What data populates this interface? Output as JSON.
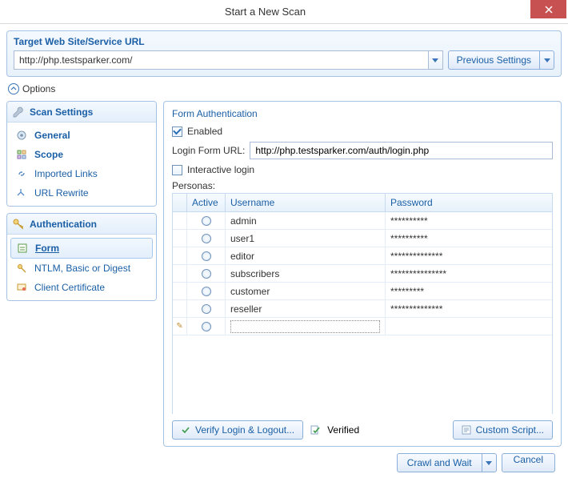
{
  "window_title": "Start a New Scan",
  "target": {
    "box_label": "Target Web Site/Service URL",
    "url": "http://php.testsparker.com/",
    "previous_settings": "Previous Settings"
  },
  "options_label": "Options",
  "sidebar": {
    "scan_settings": {
      "header": "Scan Settings",
      "items": [
        {
          "label": "General"
        },
        {
          "label": "Scope"
        },
        {
          "label": "Imported Links"
        },
        {
          "label": "URL Rewrite"
        }
      ]
    },
    "authentication": {
      "header": "Authentication",
      "items": [
        {
          "label": "Form"
        },
        {
          "label": "NTLM, Basic or Digest"
        },
        {
          "label": "Client Certificate"
        }
      ]
    }
  },
  "form_auth": {
    "title": "Form Authentication",
    "enabled_label": "Enabled",
    "enabled": true,
    "login_url_label": "Login Form URL:",
    "login_url": "http://php.testsparker.com/auth/login.php",
    "interactive_label": "Interactive login",
    "interactive": false,
    "personas_label": "Personas:",
    "columns": {
      "active": "Active",
      "username": "Username",
      "password": "Password"
    },
    "rows": [
      {
        "username": "admin",
        "password": "**********"
      },
      {
        "username": "user1",
        "password": "**********"
      },
      {
        "username": "editor",
        "password": "**************"
      },
      {
        "username": "subscribers",
        "password": "***************"
      },
      {
        "username": "customer",
        "password": "*********"
      },
      {
        "username": "reseller",
        "password": "**************"
      }
    ],
    "verify_btn": "Verify Login & Logout...",
    "verified_label": "Verified",
    "custom_script_btn": "Custom Script..."
  },
  "footer": {
    "crawl": "Crawl and Wait",
    "cancel": "Cancel"
  }
}
